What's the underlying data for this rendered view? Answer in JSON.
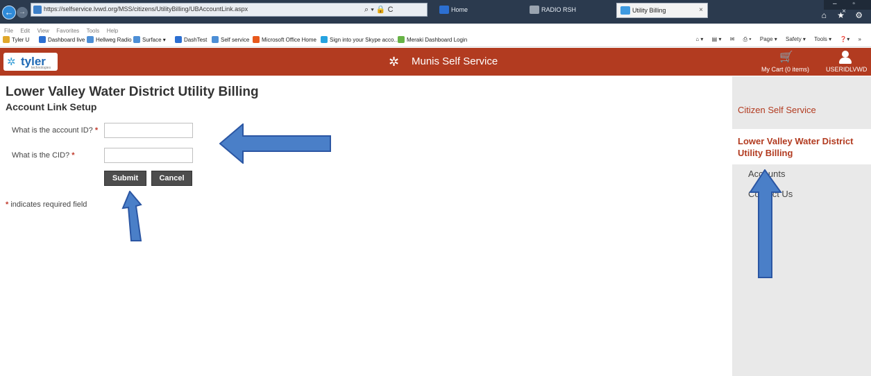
{
  "browser": {
    "back_glyph": "←",
    "forward_glyph": "→",
    "url": "https://selfservice.lvwd.org/MSS/citizens/UtilityBilling/UBAccountLink.aspx",
    "addr_tools": "⌕ ▾ 🔒 C",
    "tabs": [
      {
        "label": "Home",
        "icon_color": "#2c6fd1"
      },
      {
        "label": "RADIO RSH",
        "icon_color": "#9aa4b0"
      },
      {
        "label": "Utility Billing",
        "icon_color": "#3f9ae0"
      }
    ],
    "tab_close_glyph": "×",
    "window_controls": "– ▫ ×",
    "chrome_icons": "⌂ ★ ⚙"
  },
  "menu": [
    "File",
    "Edit",
    "View",
    "Favorites",
    "Tools",
    "Help"
  ],
  "favorites": [
    {
      "label": "Tyler U",
      "icon_color": "#e0a72b"
    },
    {
      "label": "Dashboard live",
      "icon_color": "#2c6fd1"
    },
    {
      "label": "Hellweg Radio",
      "icon_color": "#4d8fd6"
    },
    {
      "label": "Surface ▾",
      "icon_color": "#4d8fd6"
    },
    {
      "label": "DashTest",
      "icon_color": "#2c6fd1"
    },
    {
      "label": "Self service",
      "icon_color": "#4d8fd6"
    },
    {
      "label": "Microsoft Office Home",
      "icon_color": "#e8591c"
    },
    {
      "label": "Sign into your Skype acco...",
      "icon_color": "#26a3e0"
    },
    {
      "label": "Meraki Dashboard Login",
      "icon_color": "#67b346"
    }
  ],
  "command_bar": [
    "⌂ ▾",
    "▤ ▾",
    "✉",
    "⎙ ▾",
    "Page ▾",
    "Safety ▾",
    "Tools ▾",
    "❓▾",
    "»"
  ],
  "app_header": {
    "logo_mark": "✲",
    "logo_text": "tyler",
    "logo_sub": "technologies",
    "title_mark": "✲",
    "title": "Munis Self Service",
    "cart_glyph": "🛒",
    "cart_label": "My Cart (0 items)",
    "user_label": "USERIDLVWD"
  },
  "main": {
    "title": "Lower Valley Water District Utility Billing",
    "subtitle": "Account Link Setup",
    "fields": [
      {
        "label": "What is the account ID?",
        "required_mark": "*",
        "value": ""
      },
      {
        "label": "What is the CID?",
        "required_mark": "*",
        "value": ""
      }
    ],
    "submit_label": "Submit",
    "cancel_label": "Cancel",
    "required_note_mark": "*",
    "required_note": "indicates required field"
  },
  "sidebar": {
    "section": "Citizen Self Service",
    "current": "Lower Valley Water District Utility Billing",
    "links": [
      "Accounts",
      "Contact Us"
    ]
  },
  "colors": {
    "header": "#b23b20",
    "accent": "#b23b20",
    "arrow_fill": "#4a7fc8",
    "arrow_stroke": "#2b56a3",
    "button": "#4d4d4d",
    "sidebar": "#e9e9e9"
  }
}
